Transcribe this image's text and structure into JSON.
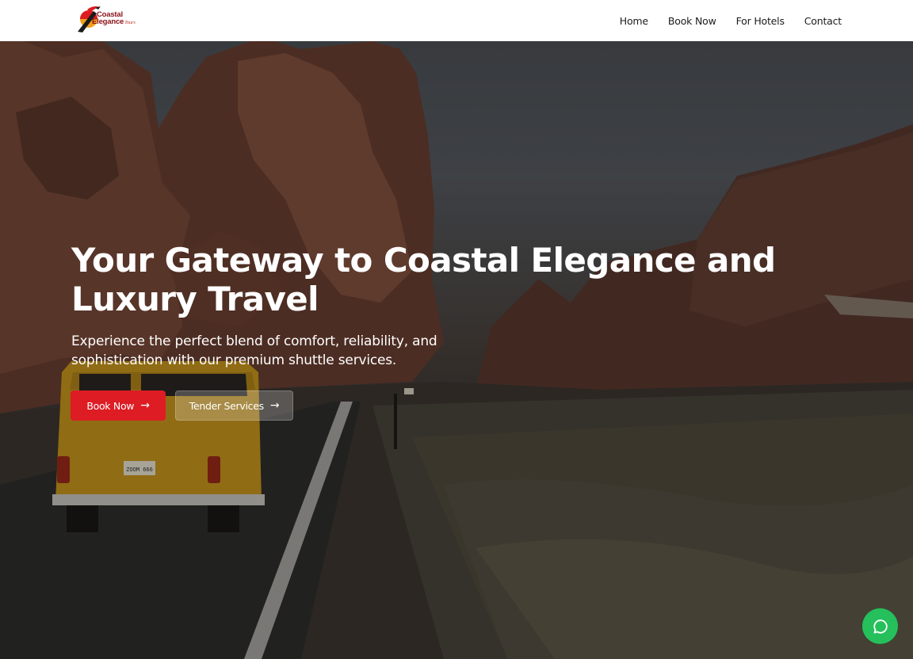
{
  "brand": {
    "line1": "Coastal",
    "line2": "Elegance",
    "line3": "Tours",
    "colors": {
      "primary": "#dd1c24",
      "dark_red": "#8b1218",
      "orange": "#f2a01b"
    }
  },
  "nav": {
    "items": [
      {
        "label": "Home"
      },
      {
        "label": "Book Now"
      },
      {
        "label": "For Hotels"
      },
      {
        "label": "Contact"
      }
    ]
  },
  "hero": {
    "headline": "Your Gateway to Coastal Elegance and Luxury Travel",
    "subline": "Experience the perfect blend of comfort, reliability, and sophistication with our premium shuttle services.",
    "primary_button": {
      "label": "Book Now",
      "icon": "arrow-right-icon"
    },
    "secondary_button": {
      "label": "Tender Services",
      "icon": "arrow-right-icon"
    },
    "van_plate": "ZOOM 666"
  },
  "chat": {
    "icon": "chat-bubble-icon",
    "color": "#25c05b"
  }
}
